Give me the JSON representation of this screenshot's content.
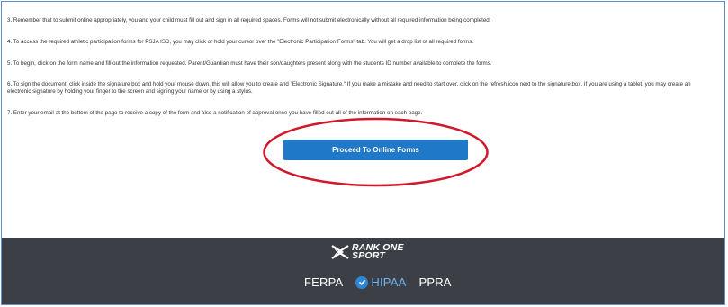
{
  "instructions": [
    "3. Remember that to submit online appropriately, you and your child must fill out and sign in all required spaces. Forms will not submit electronically without all required information being completed.",
    "4. To access the required athletic participation forms for PSJA ISD, you may click or hold your cursor over the \"Electronic Participation Forms\" tab. You will get a drop list of all required forms.",
    "5. To begin, click on the form name and fill out the information requested. Parent/Guardian must have their son/daughters present along with the students ID number available to complete the forms.",
    "6. To sign the document, click inside the signature box and hold your mouse down, this will allow you to create and \"Electronic Signature.\" If you make a mistake and need to start over, click on the refresh icon next to the signature box. If you are using a tablet, you may create an electronic signature by holding your finger to the screen and signing your name or by using a stylus.",
    "7. Enter your email at the bottom of the page to receive a copy of the form and also a notification of approval once you have filled out all of the information on each page."
  ],
  "proceed_button": {
    "label": "Proceed To Online Forms"
  },
  "footer": {
    "logo": {
      "line1": "RANK ONE",
      "line2": "SPORT",
      "icon": "rank-one-logo-icon"
    },
    "badges": {
      "ferpa": "FERPA",
      "hipaa": "HIPAA",
      "ppra": "PPRA"
    }
  },
  "colors": {
    "button": "#1f78c8",
    "footer": "#3c4046",
    "annotation_circle": "#d0182a",
    "frame_border": "#5b8fd0"
  }
}
